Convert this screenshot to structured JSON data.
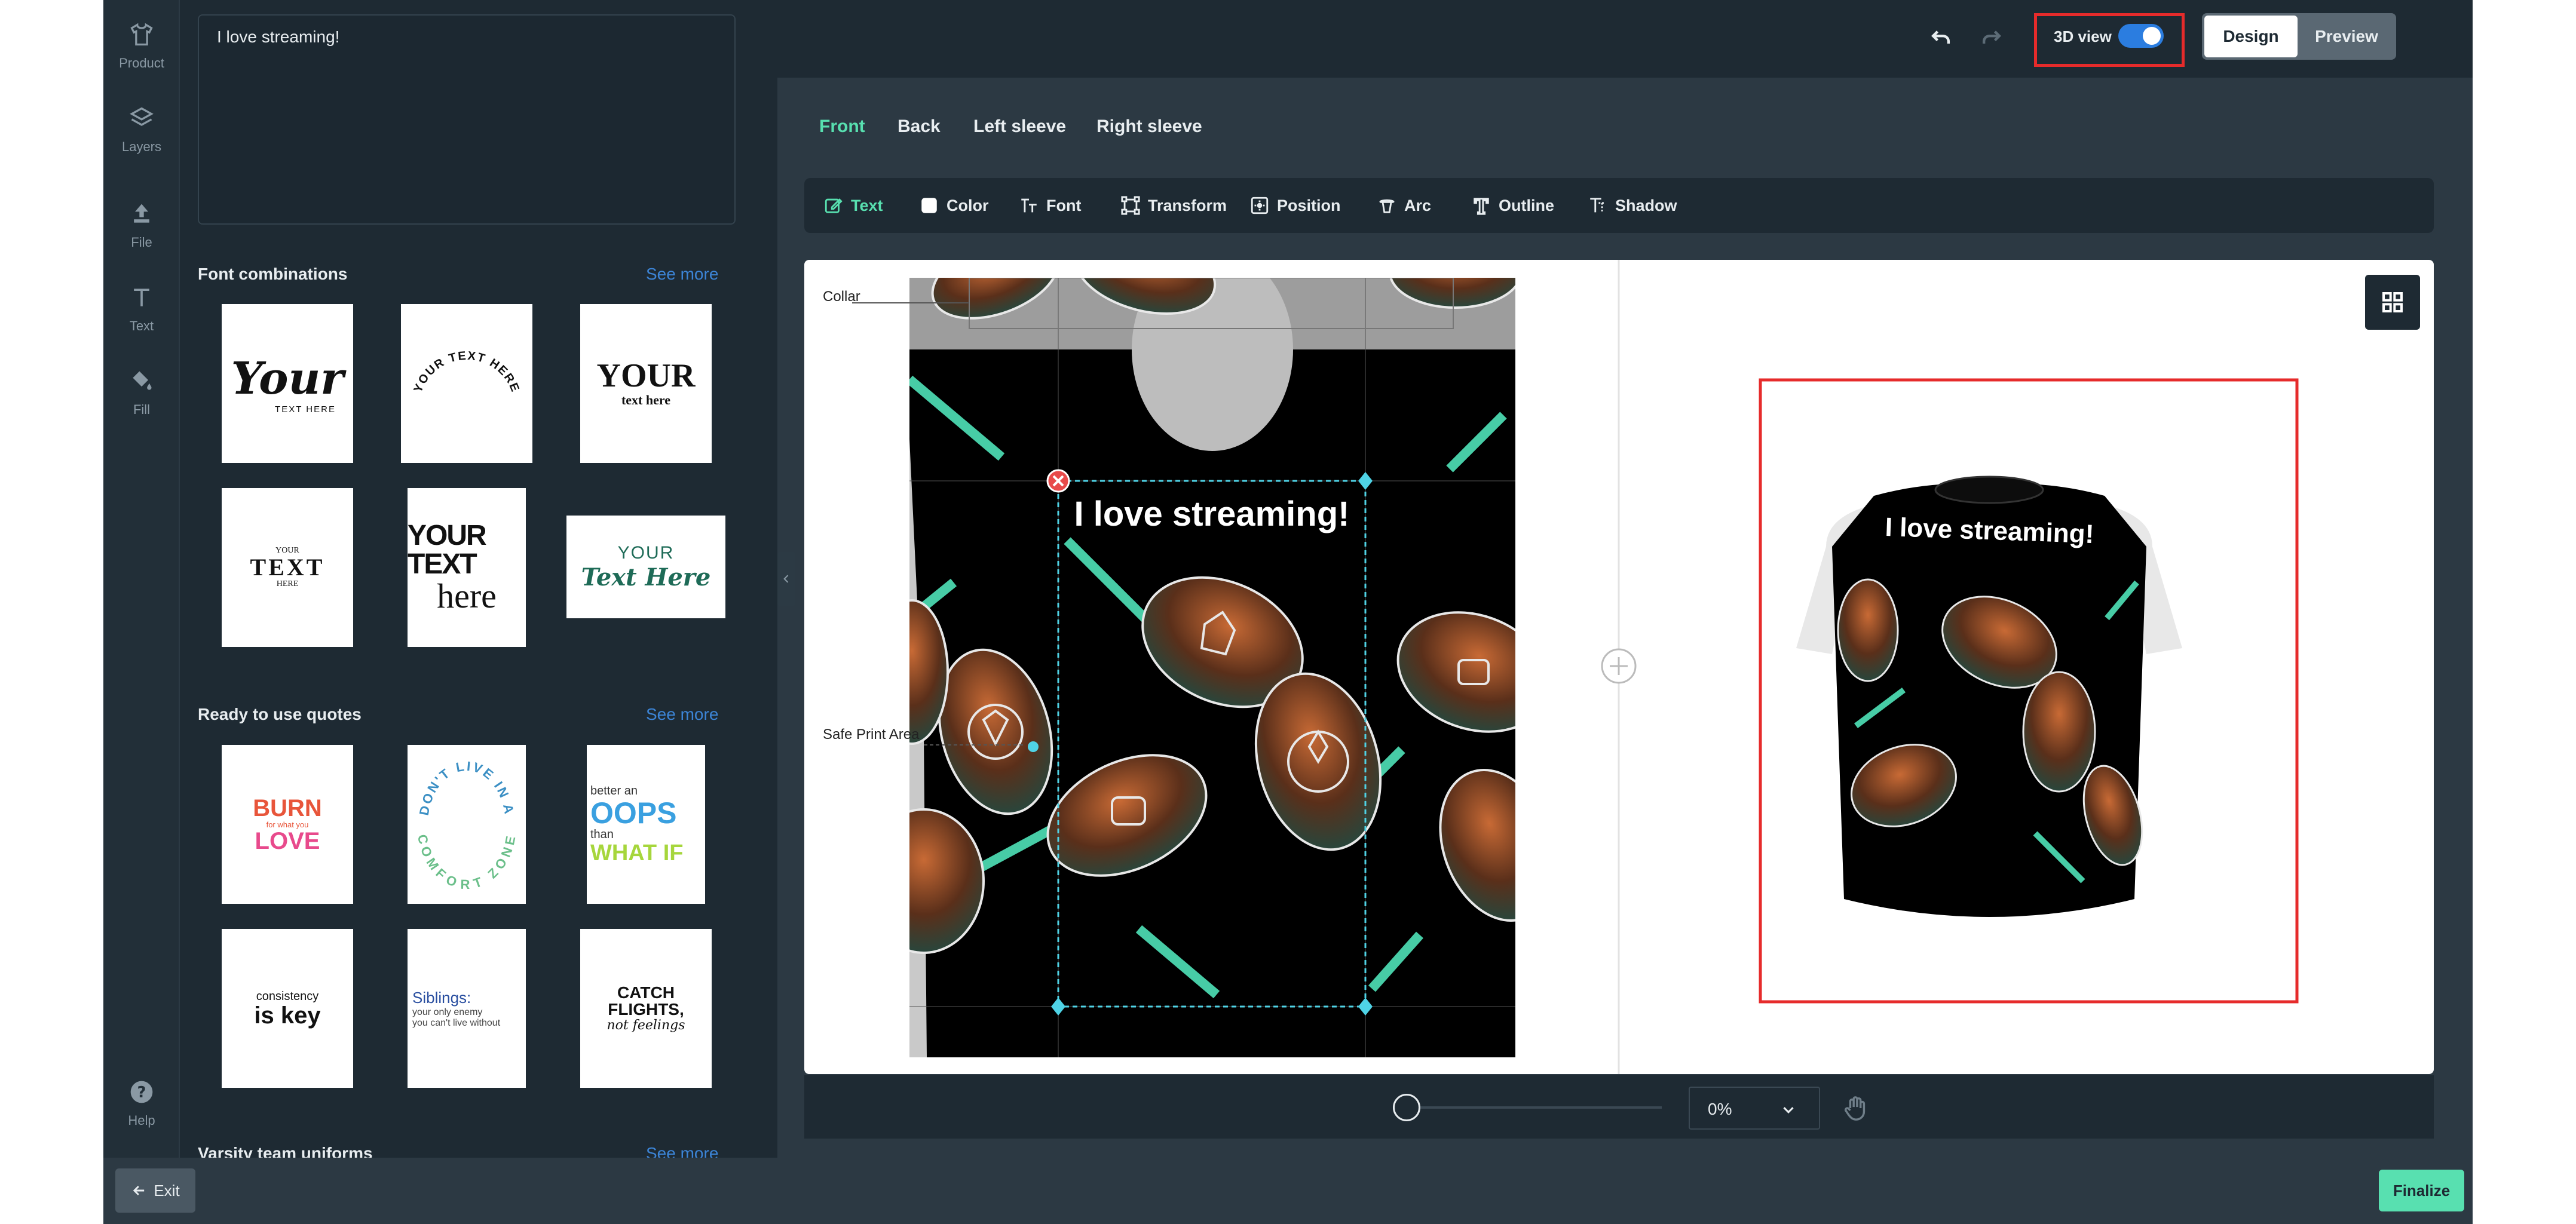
{
  "sidebar": {
    "items": [
      {
        "label": "Product",
        "icon": "shirt-icon"
      },
      {
        "label": "Layers",
        "icon": "layers-icon"
      },
      {
        "label": "File",
        "icon": "upload-icon"
      },
      {
        "label": "Text",
        "icon": "text-icon"
      },
      {
        "label": "Fill",
        "icon": "paint-bucket-icon"
      }
    ],
    "help": {
      "label": "Help",
      "icon": "help-icon"
    }
  },
  "panel": {
    "text_value": "I love streaming!",
    "font_combinations": {
      "title": "Font combinations",
      "see_more": "See more",
      "items": [
        {
          "line1": "Your",
          "line2": "TEXT HERE"
        },
        {
          "line1": "YOUR TEXT HERE"
        },
        {
          "line1": "YOUR",
          "line2": "text here"
        },
        {
          "line1": "YOUR",
          "line2": "TEXT",
          "line3": "HERE"
        },
        {
          "line1": "YOUR TEXT",
          "line2": "here"
        },
        {
          "line1": "YOUR",
          "line2": "Text Here"
        }
      ]
    },
    "quotes": {
      "title": "Ready to use quotes",
      "see_more": "See more",
      "items": [
        {
          "line1": "BURN",
          "line2": "for what you",
          "line3": "LOVE"
        },
        {
          "line1": "DON'T LIVE IN A",
          "line2": "COMFORT ZONE"
        },
        {
          "line1": "better an",
          "line2": "OOPS",
          "line3": "than",
          "line4": "WHAT IF"
        },
        {
          "line1": "consistency",
          "line2": "is key"
        },
        {
          "line1": "Siblings:",
          "line2": "your only enemy",
          "line3": "you can't live without"
        },
        {
          "line1": "CATCH",
          "line2": "FLIGHTS,",
          "line3": "not feelings"
        }
      ]
    },
    "varsity": {
      "title": "Varsity team uniforms",
      "see_more": "See more"
    }
  },
  "topbar": {
    "view_3d_label": "3D view",
    "view_3d_on": true,
    "design_label": "Design",
    "preview_label": "Preview"
  },
  "view_tabs": [
    "Front",
    "Back",
    "Left sleeve",
    "Right sleeve"
  ],
  "toolbar": {
    "tools": [
      {
        "label": "Text",
        "icon": "edit-text-icon"
      },
      {
        "label": "Color",
        "icon": "color-swatch-icon"
      },
      {
        "label": "Font",
        "icon": "font-icon"
      },
      {
        "label": "Transform",
        "icon": "transform-icon"
      },
      {
        "label": "Position",
        "icon": "position-icon"
      },
      {
        "label": "Arc",
        "icon": "arc-icon"
      },
      {
        "label": "Outline",
        "icon": "outline-icon"
      },
      {
        "label": "Shadow",
        "icon": "shadow-icon"
      }
    ]
  },
  "canvas": {
    "collar_label": "Collar",
    "safe_area_label": "Safe Print Area",
    "design_text": "I love streaming!",
    "preview_text": "I love streaming!"
  },
  "zoom": {
    "value": "0%"
  },
  "footer": {
    "exit_label": "Exit",
    "finalize_label": "Finalize"
  },
  "colors": {
    "accent": "#58e0b0",
    "toggle": "#2b7de0",
    "highlight": "#e62b2b"
  }
}
